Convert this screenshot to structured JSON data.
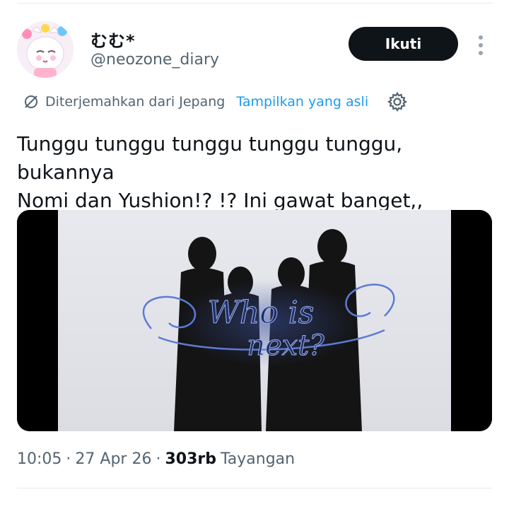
{
  "tweet": {
    "author": {
      "display_name": "むむ*",
      "handle": "@neozone_diary",
      "avatar_icon": "anime-bunny-avatar"
    },
    "follow_label": "Ikuti",
    "more_icon": "vertical-ellipsis-icon",
    "translation": {
      "icon": "translate-icon",
      "label": "Diterjemahkan dari Jepang",
      "show_original_label": "Tampilkan yang asli",
      "settings_icon": "gear-icon"
    },
    "text": "Tunggu tunggu tunggu tunggu tunggu, bukannya\nNomi dan Yushion!? !? Ini gawat banget,,",
    "media": {
      "overlay_text_line1": "Who is",
      "overlay_text_line2": "next?"
    },
    "meta": {
      "time": "10:05",
      "separator": "·",
      "date": "27 Apr 26",
      "views_count": "303rb",
      "views_label": "Tayangan"
    }
  },
  "colors": {
    "text_primary": "#0f1419",
    "text_secondary": "#536471",
    "link": "#1d9bf0",
    "button_bg": "#0f1419"
  }
}
